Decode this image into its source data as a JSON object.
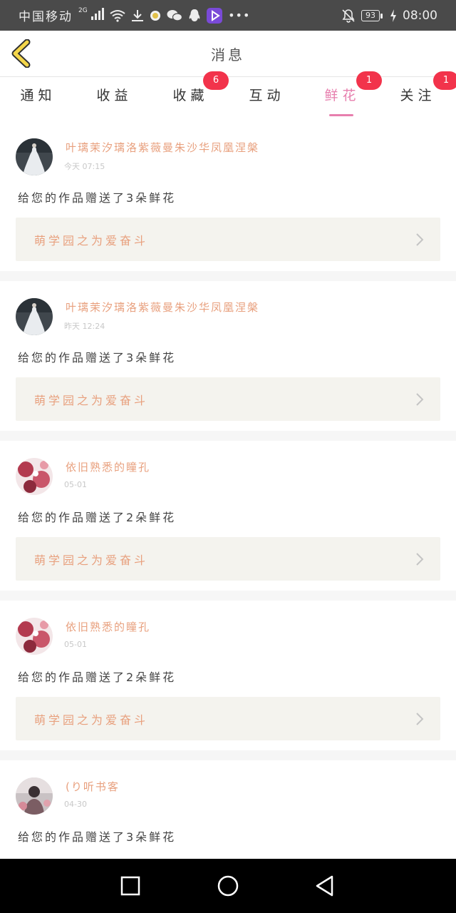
{
  "status_bar": {
    "carrier": "中国移动",
    "network": "2G",
    "battery": "93",
    "time": "08:00"
  },
  "header": {
    "title": "消息"
  },
  "tabs": [
    {
      "label": "通知",
      "badge": ""
    },
    {
      "label": "收益",
      "badge": ""
    },
    {
      "label": "收藏",
      "badge": "6"
    },
    {
      "label": "互动",
      "badge": ""
    },
    {
      "label": "鲜花",
      "badge": "1",
      "active": true
    },
    {
      "label": "关注",
      "badge": "1"
    }
  ],
  "feed": [
    {
      "name": "叶璃茉汐璃洛紫薇曼朱沙华凤凰涅槃",
      "time": "今天 07:15",
      "message": "给您的作品赠送了3朵鲜花",
      "work": "萌学园之为爱奋斗"
    },
    {
      "name": "叶璃茉汐璃洛紫薇曼朱沙华凤凰涅槃",
      "time": "昨天 12:24",
      "message": "给您的作品赠送了3朵鲜花",
      "work": "萌学园之为爱奋斗"
    },
    {
      "name": "依旧熟悉的瞳孔",
      "time": "05-01",
      "message": "给您的作品赠送了2朵鲜花",
      "work": "萌学园之为爱奋斗"
    },
    {
      "name": "依旧熟悉的瞳孔",
      "time": "05-01",
      "message": "给您的作品赠送了2朵鲜花",
      "work": "萌学园之为爱奋斗"
    },
    {
      "name": "(り听书客",
      "time": "04-30",
      "message": "给您的作品赠送了3朵鲜花",
      "work": ""
    }
  ],
  "colors": {
    "accent": "#e77fae",
    "name": "#e8a07e",
    "badge": "#f2334b",
    "back_arrow": "#f4d64a"
  },
  "icons": {
    "back": "chevron-left-icon",
    "nav": [
      "square-recents-icon",
      "circle-home-icon",
      "triangle-back-icon"
    ]
  }
}
